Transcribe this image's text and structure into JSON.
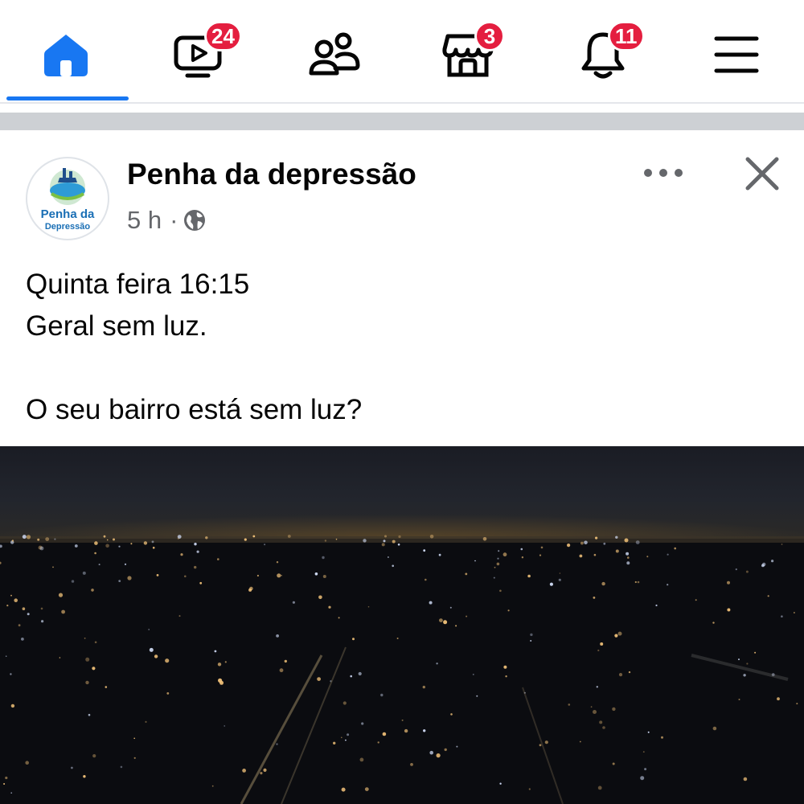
{
  "nav": {
    "items": [
      {
        "id": "home",
        "icon": "home-icon",
        "active": true,
        "badge": ""
      },
      {
        "id": "watch",
        "icon": "video-icon",
        "active": false,
        "badge": "24"
      },
      {
        "id": "friends",
        "icon": "friends-icon",
        "active": false,
        "badge": ""
      },
      {
        "id": "marketplace",
        "icon": "marketplace-icon",
        "active": false,
        "badge": "3"
      },
      {
        "id": "notifications",
        "icon": "bell-icon",
        "active": false,
        "badge": "11"
      },
      {
        "id": "menu",
        "icon": "hamburger-menu-icon",
        "active": false,
        "badge": ""
      }
    ],
    "accent_color": "#1877f2",
    "badge_color": "#e41e3f"
  },
  "post": {
    "page_name": "Penha da depressão",
    "time": "5 h",
    "separator": "·",
    "privacy_icon": "globe-icon",
    "avatar_text_line1": "Penha da",
    "avatar_text_line2": "Depressão",
    "text_lines": [
      "Quinta feira 16:15",
      "Geral sem luz.",
      "",
      "O seu bairro está sem luz?"
    ],
    "more_icon": "more-options-icon",
    "close_icon": "close-icon",
    "media_description_icon": "night-city-photo"
  }
}
